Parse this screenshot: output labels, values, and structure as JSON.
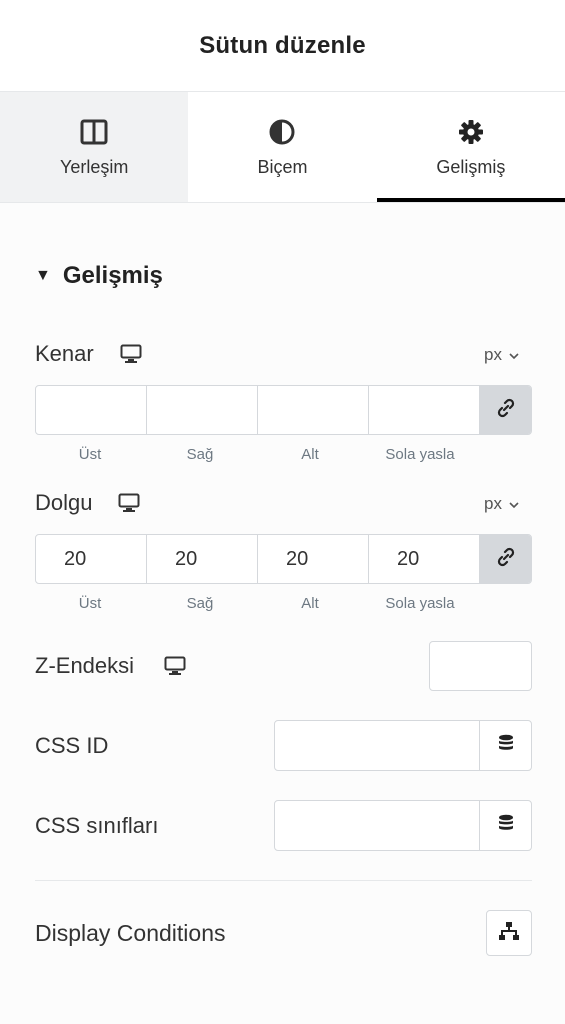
{
  "header": {
    "title": "Sütun düzenle"
  },
  "tabs": [
    {
      "label": "Yerleşim",
      "icon": "columns-icon"
    },
    {
      "label": "Biçem",
      "icon": "contrast-icon"
    },
    {
      "label": "Gelişmiş",
      "icon": "gear-icon",
      "active": true
    }
  ],
  "section": {
    "title": "Gelişmiş"
  },
  "margin": {
    "label": "Kenar",
    "unit": "px",
    "values": [
      "",
      "",
      "",
      ""
    ],
    "sides": [
      "Üst",
      "Sağ",
      "Alt",
      "Sola yasla"
    ]
  },
  "padding": {
    "label": "Dolgu",
    "unit": "px",
    "values": [
      "20",
      "20",
      "20",
      "20"
    ],
    "sides": [
      "Üst",
      "Sağ",
      "Alt",
      "Sola yasla"
    ]
  },
  "zindex": {
    "label": "Z-Endeksi",
    "value": ""
  },
  "css_id": {
    "label": "CSS ID",
    "value": ""
  },
  "css_classes": {
    "label": "CSS sınıfları",
    "value": ""
  },
  "display_conditions": {
    "label": "Display Conditions"
  }
}
